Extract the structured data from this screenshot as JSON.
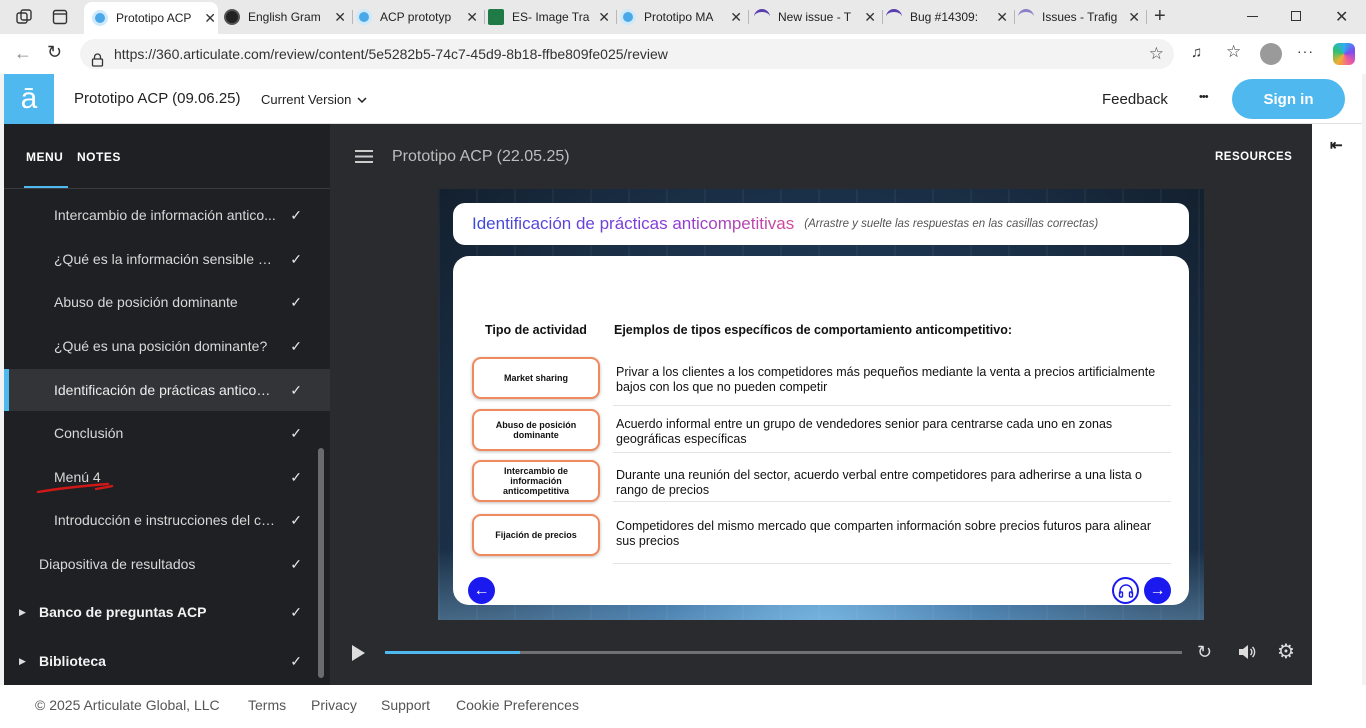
{
  "browser": {
    "tabs": [
      {
        "title": "Prototipo ACP",
        "active": true,
        "color": "#4aa8e8"
      },
      {
        "title": "English Gram",
        "color": "#222222"
      },
      {
        "title": "ACP prototyp",
        "color": "#4aa8e8"
      },
      {
        "title": "ES- Image Tra",
        "color": "#1f7a45"
      },
      {
        "title": "Prototipo MA",
        "color": "#4aa8e8"
      },
      {
        "title": "New issue - T",
        "color": "#5a3fb0"
      },
      {
        "title": "Bug #14309:",
        "color": "#5a3fb0"
      },
      {
        "title": "Issues - Trafig",
        "color": "#8a7fc8"
      }
    ],
    "url": "https://360.articulate.com/review/content/5e5282b5-74c7-45d9-8b18-ffbe809fe025/review"
  },
  "header": {
    "logo": "ā",
    "project_title": "Prototipo ACP (09.06.25)",
    "version_label": "Current Version",
    "feedback_label": "Feedback",
    "more_label": "•••",
    "signin_label": "Sign in"
  },
  "sidebar": {
    "tabs": [
      "MENU",
      "NOTES"
    ],
    "items": [
      {
        "label": "Intercambio de información antico...",
        "check": "✓"
      },
      {
        "label": "¿Qué es la información sensible de...",
        "check": "✓"
      },
      {
        "label": "Abuso de posición dominante",
        "check": "✓"
      },
      {
        "label": "¿Qué es una posición dominante?",
        "check": "✓"
      },
      {
        "label": "Identificación de prácticas anticom...",
        "check": "✓"
      },
      {
        "label": "Conclusión",
        "check": "✓"
      },
      {
        "label": "Menú 4",
        "check": "✓"
      },
      {
        "label": "Introducción e instrucciones del cu...",
        "check": "✓"
      },
      {
        "label": "Diapositiva de resultados",
        "check": "✓"
      },
      {
        "label": "Banco de preguntas ACP",
        "check": "✓"
      },
      {
        "label": "Biblioteca",
        "check": "✓"
      }
    ]
  },
  "player": {
    "course_title": "Prototipo ACP (22.05.25)",
    "resources_label": "RESOURCES",
    "progress": 0.17
  },
  "slide": {
    "title": "Identificación de prácticas anticompetitivas",
    "instruction": "(Arrastre y suelte las respuestas en las casillas correctas)",
    "col1_header": "Tipo de actividad",
    "col2_header": "Ejemplos de tipos específicos de comportamiento anticompetitivo:",
    "rows": [
      {
        "activity": "Market sharing",
        "example": "Privar a los clientes a los competidores más pequeños mediante la venta a precios artificialmente bajos con los que no pueden competir"
      },
      {
        "activity": "Abuso de posición dominante",
        "example": "Acuerdo informal entre un grupo de vendedores senior para centrarse cada uno en zonas geográficas específicas"
      },
      {
        "activity": "Intercambio de información anticompetitiva",
        "example": "Durante una reunión del sector, acuerdo verbal entre competidores para adherirse a una lista o rango de precios"
      },
      {
        "activity": "Fijación de precios",
        "example": "Competidores del mismo mercado que comparten información sobre precios futuros para alinear sus precios"
      }
    ]
  },
  "footer": {
    "copyright": "© 2025 Articulate Global, LLC",
    "links": [
      "Terms",
      "Privacy",
      "Support",
      "Cookie Preferences"
    ]
  },
  "colors": {
    "accent": "#4fb8ee",
    "sidebar_bg": "#1f2023",
    "slide_nav_blue": "#1a1aee",
    "pill_border": "#f08a5d"
  }
}
